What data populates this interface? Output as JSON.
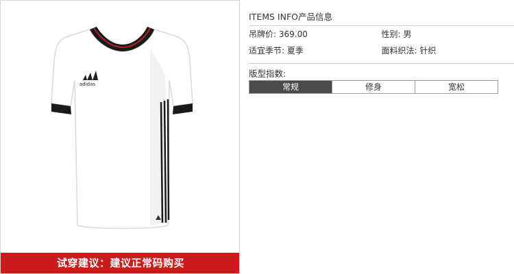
{
  "info": {
    "title": "ITEMS INFO产品信息",
    "specs": [
      {
        "label": "吊牌价:",
        "value": "369.00"
      },
      {
        "label": "性别:",
        "value": "男"
      },
      {
        "label": "适宜季节:",
        "value": "夏季"
      },
      {
        "label": "面料织法:",
        "value": "针织"
      }
    ]
  },
  "fit_index": {
    "label": "版型指数:",
    "options": [
      "常规",
      "修身",
      "宽松"
    ],
    "selected": "常规"
  },
  "banner": {
    "text": "试穿建议：建议正常码购买"
  },
  "product": {
    "brand_logo": "adidas",
    "colors": {
      "shirt": "#ffffff",
      "trim": "#1a1a1a",
      "collar_accent": "#b0212a"
    }
  },
  "colors": {
    "banner_bg": "#cc1b1b",
    "active_segment": "#4a4a4a"
  }
}
